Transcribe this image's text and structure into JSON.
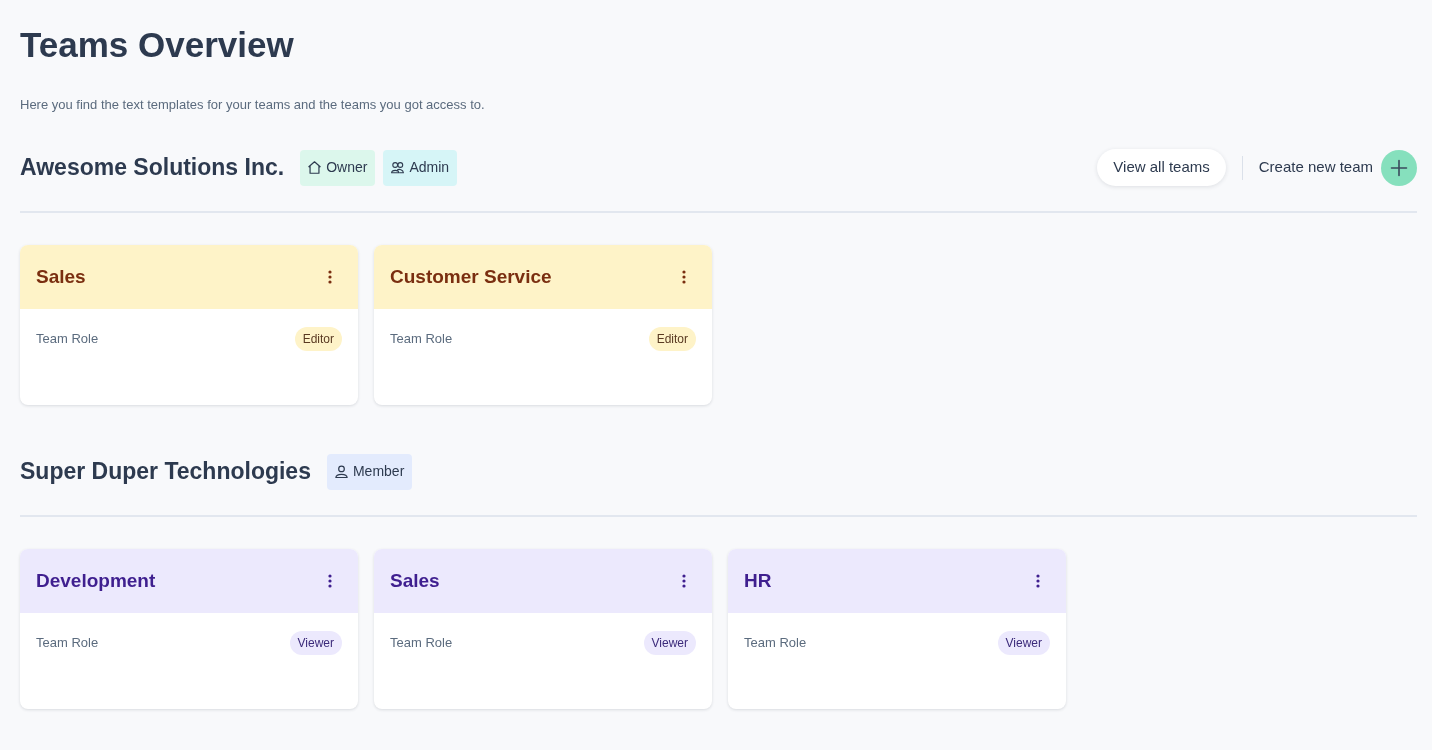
{
  "page": {
    "title": "Teams Overview",
    "subtitle": "Here you find the text templates for your teams and the teams you got access to."
  },
  "organizations": [
    {
      "name": "Awesome Solutions Inc.",
      "roles": [
        {
          "label": "Owner",
          "kind": "owner"
        },
        {
          "label": "Admin",
          "kind": "admin"
        }
      ],
      "actions": [
        {
          "label": "View all teams",
          "kind": "pill"
        },
        {
          "label": "Create new team",
          "kind": "create"
        }
      ],
      "teams": [
        {
          "name": "Sales",
          "role_label": "Team Role",
          "role": {
            "label": "Editor",
            "kind": "editor"
          }
        },
        {
          "name": "Customer Service",
          "role_label": "Team Role",
          "role": {
            "label": "Editor",
            "kind": "editor"
          }
        }
      ]
    },
    {
      "name": "Super Duper Technologies",
      "roles": [
        {
          "label": "Member",
          "kind": "member"
        }
      ],
      "teams": [
        {
          "name": "Development",
          "role_label": "Team Role",
          "role": {
            "label": "Viewer",
            "kind": "viewer"
          }
        },
        {
          "name": "Sales",
          "role_label": "Team Role",
          "role": {
            "label": "Viewer",
            "kind": "viewer"
          }
        },
        {
          "name": "HR",
          "role_label": "Team Role",
          "role": {
            "label": "Viewer",
            "kind": "viewer"
          }
        }
      ]
    }
  ]
}
